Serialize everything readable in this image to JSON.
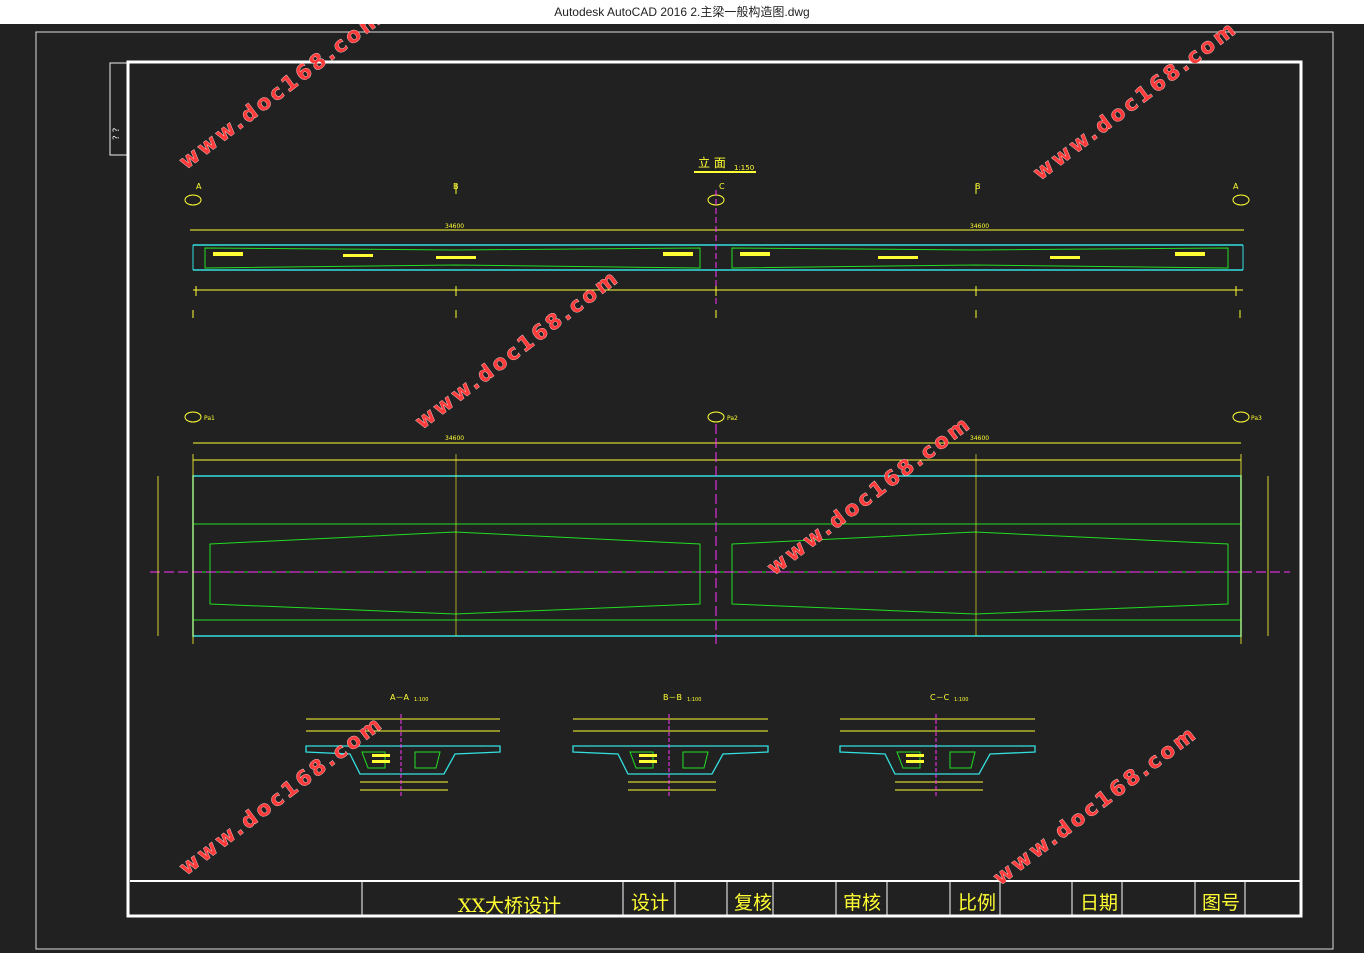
{
  "window": {
    "title": "Autodesk AutoCAD 2016     2.主梁一般构造图.dwg"
  },
  "drawing": {
    "side_mark": "? ?",
    "elevation_title": "立  面",
    "elevation_scale": "1:150",
    "section_labels": [
      "A",
      "B",
      "C",
      "B",
      "A"
    ],
    "elevation_dims": [
      "34600",
      "34600"
    ],
    "plan_dims": [
      "34600",
      "34600"
    ],
    "pier_labels": [
      "Pa1",
      "Pa2",
      "Pa3"
    ],
    "sections": [
      {
        "title": "A－A",
        "scale": "1:100"
      },
      {
        "title": "B－B",
        "scale": "1:100"
      },
      {
        "title": "C－C",
        "scale": "1:100"
      }
    ]
  },
  "title_block": {
    "project": "XX大桥设计",
    "design": "设计",
    "review": "复核",
    "approve": "审核",
    "scale": "比例",
    "date": "日期",
    "drawing_no": "图号"
  },
  "watermark": {
    "text": "www.doc168.com"
  },
  "colors": {
    "background": "#212121",
    "yellow": "#ffff33",
    "cyan": "#33e0e0",
    "green": "#22dd22",
    "magenta": "#ff33ff",
    "watermark": "#ff3b3b"
  }
}
